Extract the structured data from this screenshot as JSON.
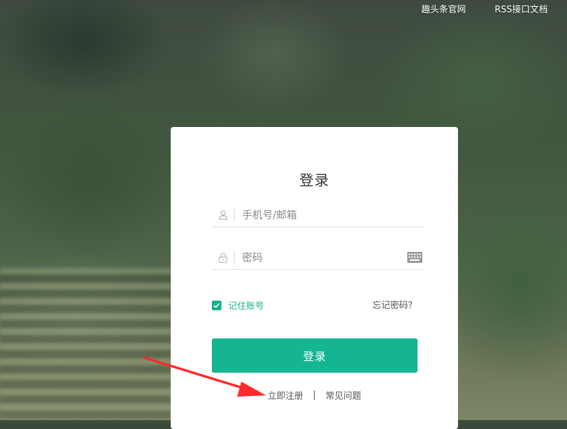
{
  "topnav": {
    "official_site": "趣头条官网",
    "rss_docs": "RSS接口文档"
  },
  "login": {
    "title": "登录",
    "username_placeholder": "手机号/邮箱",
    "password_placeholder": "密码",
    "remember_label": "记住账号",
    "remember_checked": true,
    "forgot_label": "忘记密码？",
    "submit_label": "登录",
    "register_label": "立即注册",
    "separator": "|",
    "faq_label": "常见问题"
  },
  "colors": {
    "accent": "#15b592",
    "annotation_arrow": "#ff2a2a"
  }
}
